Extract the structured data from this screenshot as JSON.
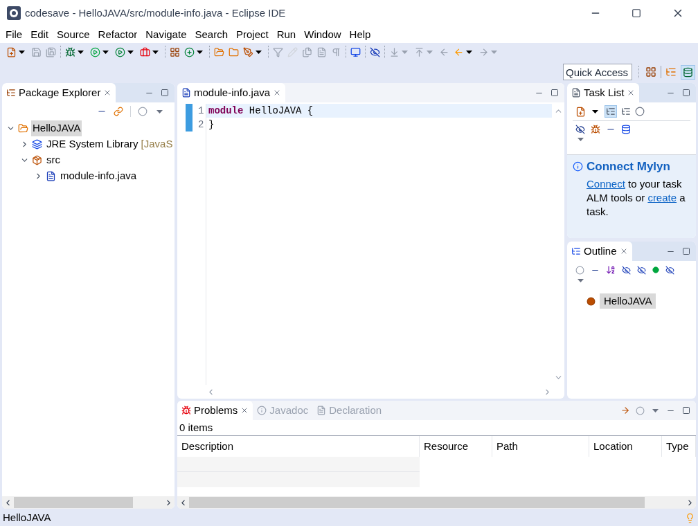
{
  "window": {
    "title": "codesave - HelloJAVA/src/module-info.java - Eclipse IDE"
  },
  "menu": [
    "File",
    "Edit",
    "Source",
    "Refactor",
    "Navigate",
    "Search",
    "Project",
    "Run",
    "Window",
    "Help"
  ],
  "quick_access": {
    "placeholder": "Quick Access"
  },
  "package_explorer": {
    "tab": {
      "label": "Package Explorer",
      "selected": true
    },
    "tree": [
      {
        "label": "HelloJAVA",
        "kind": "project",
        "expanded": true,
        "selected": true,
        "children": [
          {
            "label": "JRE System Library",
            "suffix": "[JavaS",
            "kind": "library",
            "expanded": false,
            "selected": false
          },
          {
            "label": "src",
            "kind": "source-folder",
            "expanded": true,
            "selected": false,
            "children": [
              {
                "label": "module-info.java",
                "kind": "java-file",
                "expanded": false,
                "selected": false
              }
            ]
          }
        ]
      }
    ]
  },
  "editor": {
    "tab": {
      "label": "module-info.java",
      "selected": true
    },
    "lines": [
      {
        "number": "1",
        "current": true,
        "tokens": [
          {
            "text": "module",
            "kind": "keyword"
          },
          {
            "text": " HelloJAVA {",
            "kind": "plain"
          }
        ]
      },
      {
        "number": "2",
        "current": false,
        "tokens": [
          {
            "text": "}",
            "kind": "plain"
          }
        ]
      }
    ]
  },
  "task_list": {
    "tab": {
      "label": "Task List",
      "selected": true
    },
    "connect": {
      "title": "Connect Mylyn",
      "link_1": "Connect",
      "text_1": " to your task ALM tools or ",
      "link_2": "create",
      "text_2": " a task."
    }
  },
  "outline": {
    "tab": {
      "label": "Outline",
      "selected": true
    },
    "items": [
      {
        "label": "HelloJAVA",
        "selected": true
      }
    ]
  },
  "bottom": {
    "tabs": [
      {
        "label": "Problems",
        "selected": true
      },
      {
        "label": "Javadoc",
        "selected": false
      },
      {
        "label": "Declaration",
        "selected": false
      }
    ],
    "summary": "0 items",
    "columns": [
      "Description",
      "Resource",
      "Path",
      "Location",
      "Type"
    ]
  },
  "status_bar": {
    "text": "HelloJAVA"
  }
}
